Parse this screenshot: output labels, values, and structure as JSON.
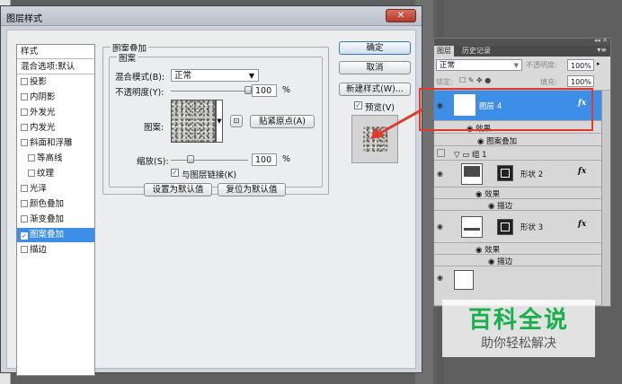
{
  "dialog": {
    "title": "图层样式",
    "close_label": "✕"
  },
  "style_list": {
    "header": "样式",
    "items": [
      {
        "label": "混合选项:默认",
        "checkbox": false,
        "selected": false
      },
      {
        "label": "投影",
        "checkbox": true,
        "checked": false
      },
      {
        "label": "内阴影",
        "checkbox": true,
        "checked": false
      },
      {
        "label": "外发光",
        "checkbox": true,
        "checked": false
      },
      {
        "label": "内发光",
        "checkbox": true,
        "checked": false
      },
      {
        "label": "斜面和浮雕",
        "checkbox": true,
        "checked": false
      },
      {
        "label": "等高线",
        "checkbox": true,
        "checked": false,
        "indent": true
      },
      {
        "label": "纹理",
        "checkbox": true,
        "checked": false,
        "indent": true
      },
      {
        "label": "光泽",
        "checkbox": true,
        "checked": false
      },
      {
        "label": "颜色叠加",
        "checkbox": true,
        "checked": false
      },
      {
        "label": "渐变叠加",
        "checkbox": true,
        "checked": false
      },
      {
        "label": "图案叠加",
        "checkbox": true,
        "checked": true,
        "selected": true
      },
      {
        "label": "描边",
        "checkbox": true,
        "checked": false
      }
    ]
  },
  "pattern_overlay": {
    "group_title": "图案叠加",
    "sub_group_title": "图案",
    "blend_mode_label": "混合模式(B):",
    "blend_mode_value": "正常",
    "opacity_label": "不透明度(Y):",
    "opacity_value": "100",
    "opacity_unit": "%",
    "opacity_level": 1.0,
    "pattern_label": "图案:",
    "snap_origin_label": "贴紧原点(A)",
    "scale_label": "缩放(S):",
    "scale_value": "100",
    "scale_unit": "%",
    "scale_level": 0.22,
    "link_label": "与图层链接(K)",
    "link_checked": true,
    "make_default_label": "设置为默认值",
    "reset_default_label": "复位为默认值"
  },
  "right_buttons": {
    "ok": "确定",
    "cancel": "取消",
    "new_style": "新建样式(W)...",
    "preview_label": "预览(V)",
    "preview_checked": true
  },
  "layers_panel": {
    "tabs": [
      "图层",
      "历史记录"
    ],
    "blend_mode": "正常",
    "opacity_label": "不透明度:",
    "opacity_value": "100%",
    "lock_label": "锁定:",
    "fill_label": "填充:",
    "fill_value": "100%",
    "rows": [
      {
        "name": "图层 4",
        "fx": "fx",
        "selected": true
      },
      {
        "name": "效果"
      },
      {
        "name": "图案叠加"
      },
      {
        "name": "组 1"
      },
      {
        "name": "形状 2",
        "fx": "fx"
      },
      {
        "name": "效果"
      },
      {
        "name": "描边"
      },
      {
        "name": "形状 3",
        "fx": "fx"
      },
      {
        "name": "效果"
      },
      {
        "name": "描边"
      }
    ]
  },
  "watermark": {
    "title": "百科全说",
    "subtitle": "助你轻松解决"
  },
  "colors": {
    "selection_blue": "#3d8ee6",
    "highlight_red": "#e03a2e",
    "watermark_green": "#18b04a"
  }
}
